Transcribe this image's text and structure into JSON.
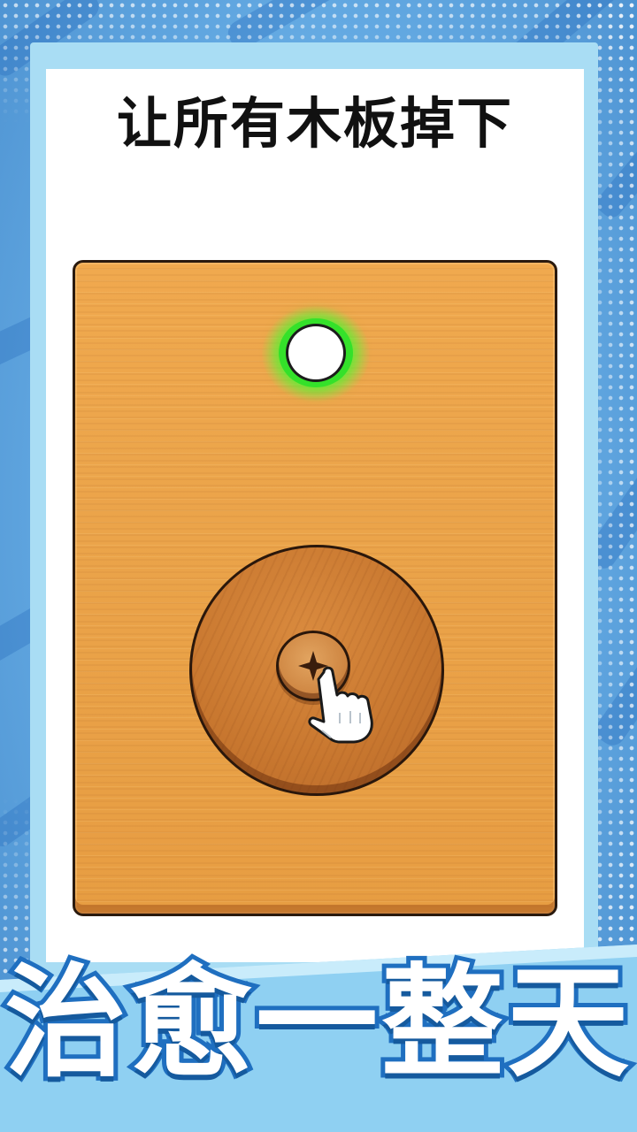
{
  "level": {
    "instruction": "让所有木板掉下"
  },
  "board": {
    "hole_glow_color": "#34e12a",
    "wood_color": "#eba44a",
    "plank_color": "#c8772f"
  },
  "promo": {
    "slogan": "治愈一整天",
    "slogan_fill_color": "#ffffff",
    "slogan_outline_color": "#1f6fc0"
  },
  "icons": {
    "screw": "phillips-screw-icon",
    "pointer": "tap-hand-icon",
    "empty_hole": "empty-hole-icon"
  }
}
